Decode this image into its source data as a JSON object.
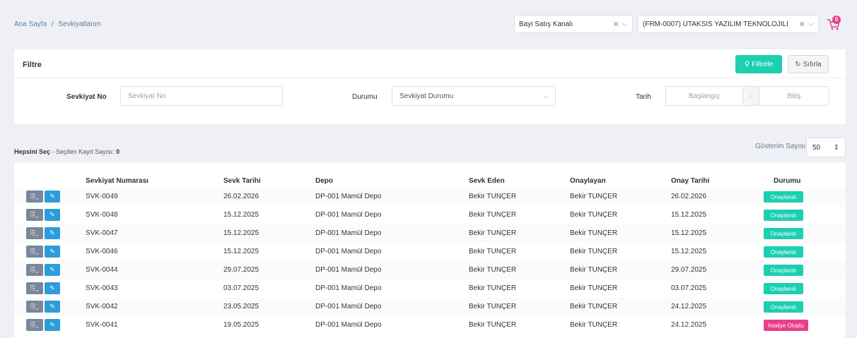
{
  "breadcrumb": {
    "home": "Ana Sayfa",
    "sep": "/",
    "current": "Sevkiyatlarım"
  },
  "header": {
    "channel_select": "Bayi Satış Kanalı",
    "company_select": "(FRM-0007) ÜTAKSİS YAZILIM TEKNOLOJİLİ",
    "cart_count": "0"
  },
  "filter": {
    "title": "Filtre",
    "filter_button": "Filtrele",
    "reset_button": "Sıfırla",
    "shipment_no_label": "Sevkiyat No",
    "shipment_no_placeholder": "Sevkiyat No",
    "status_label": "Durumu",
    "status_placeholder": "Sevkiyat Durumu",
    "date_label": "Tarih",
    "date_start_placeholder": "Başlangıç",
    "date_sep": "-",
    "date_end_placeholder": "Bitiş"
  },
  "list": {
    "select_all": "Hepsini Seç",
    "selected_count_label": "- Seçilen Kayıt Sayısı:",
    "selected_count": "0",
    "show_count_label": "Gösterim Sayısı",
    "show_count": "50"
  },
  "table": {
    "headers": [
      "Sevkiyat Numarası",
      "Sevk Tarihi",
      "Depo",
      "Sevk Eden",
      "Onaylayan",
      "Onay Tarihi",
      "Durumu"
    ],
    "rows": [
      {
        "no": "SVK-0049",
        "date": "26.02.2026",
        "depot": "DP-001 Mamül Depo",
        "by": "Bekir TUNÇER",
        "approver": "Bekir TUNÇER",
        "approve_date": "26.02.2026",
        "status": "Onaylandı"
      },
      {
        "no": "SVK-0048",
        "date": "15.12.2025",
        "depot": "DP-001 Mamül Depo",
        "by": "Bekir TUNÇER",
        "approver": "Bekir TUNÇER",
        "approve_date": "15.12.2025",
        "status": "Onaylandı"
      },
      {
        "no": "SVK-0047",
        "date": "15.12.2025",
        "depot": "DP-001 Mamül Depo",
        "by": "Bekir TUNÇER",
        "approver": "Bekir TUNÇER",
        "approve_date": "15.12.2025",
        "status": "Onaylandı"
      },
      {
        "no": "SVK-0046",
        "date": "15.12.2025",
        "depot": "DP-001 Mamül Depo",
        "by": "Bekir TUNÇER",
        "approver": "Bekir TUNÇER",
        "approve_date": "15.12.2025",
        "status": "Onaylandı"
      },
      {
        "no": "SVK-0044",
        "date": "29.07.2025",
        "depot": "DP-001 Mamül Depo",
        "by": "Bekir TUNÇER",
        "approver": "Bekir TUNÇER",
        "approve_date": "29.07.2025",
        "status": "Onaylandı"
      },
      {
        "no": "SVK-0043",
        "date": "03.07.2025",
        "depot": "DP-001 Mamül Depo",
        "by": "Bekir TUNÇER",
        "approver": "Bekir TUNÇER",
        "approve_date": "03.07.2025",
        "status": "Onaylandı"
      },
      {
        "no": "SVK-0042",
        "date": "23.05.2025",
        "depot": "DP-001 Mamül Depo",
        "by": "Bekir TUNÇER",
        "approver": "Bekir TUNÇER",
        "approve_date": "24.12.2025",
        "status": "Onaylandı"
      },
      {
        "no": "SVK-0041",
        "date": "19.05.2025",
        "depot": "DP-001 Mamül Depo",
        "by": "Bekir TUNÇER",
        "approver": "Bekir TUNÇER",
        "approve_date": "24.12.2025",
        "status": "İrsaliye Oluştu"
      }
    ]
  },
  "colors": {
    "approved": "#1ccfb0",
    "waybill": "#e83e8c",
    "accent": "#1ccfb0"
  }
}
